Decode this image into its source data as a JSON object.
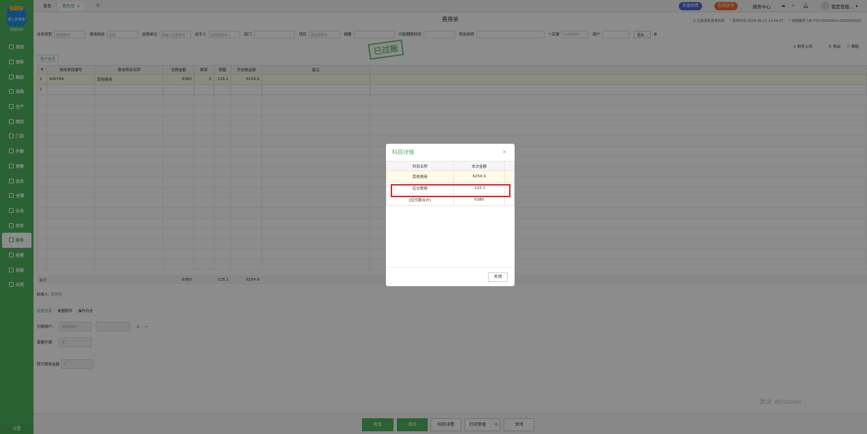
{
  "sidebar": {
    "logo_badge": "资讯企业",
    "logo_text": "网上管家婆",
    "brand": "网店ERP",
    "items": [
      {
        "label": "常用",
        "active": false
      },
      {
        "label": "资料",
        "active": false
      },
      {
        "label": "期初",
        "active": false
      },
      {
        "label": "采购",
        "active": false
      },
      {
        "label": "生产",
        "active": false
      },
      {
        "label": "网店",
        "active": false
      },
      {
        "label": "门店",
        "active": false
      },
      {
        "label": "外勤",
        "active": false
      },
      {
        "label": "销售",
        "active": false
      },
      {
        "label": "会员",
        "active": false
      },
      {
        "label": "仓储",
        "active": false
      },
      {
        "label": "云仓",
        "active": false
      },
      {
        "label": "库存",
        "active": false
      },
      {
        "label": "财务",
        "active": true
      },
      {
        "label": "经营",
        "active": false
      },
      {
        "label": "系统",
        "active": false
      },
      {
        "label": "应用",
        "active": false
      }
    ],
    "settings": "设置"
  },
  "topbar": {
    "tabs": [
      {
        "label": "首页"
      },
      {
        "label": "费用单",
        "close": "×"
      }
    ],
    "recharge": "充值续费",
    "consult": "在线咨询",
    "service": "服务中心",
    "user": "我是管理..."
  },
  "doc": {
    "title": "费用单",
    "posted_label": "过账更新录单时间",
    "date_label": "* 录单时间",
    "date": "2024-06-21 23:44:37",
    "no_label": "* 单据编号",
    "no": "CW-FYD-20240621-0000000001",
    "stamp": "已过账",
    "filters": [
      {
        "label": "业务类型",
        "value": "普通费用",
        "w": 46
      },
      {
        "label": "费用用途",
        "value": "采购",
        "w": 46
      },
      {
        "label": "结算单位",
        "value": "请输入往来单位",
        "w": 46
      },
      {
        "label": "经手人",
        "value": "请选择经手人",
        "w": 46
      },
      {
        "label": "部门",
        "value": "",
        "w": 60
      },
      {
        "label": "项目",
        "value": "请选择项目",
        "w": 46
      },
      {
        "label": "摘要",
        "value": "",
        "w": 60
      },
      {
        "label": "付款期限时间",
        "value": "",
        "w": 46
      },
      {
        "label": "附加说明",
        "value": "",
        "w": 100
      },
      {
        "label": "* 店铺",
        "value": "test0006",
        "w": 40
      },
      {
        "label": "账户",
        "value": "",
        "w": 40
      }
    ],
    "more": "更多...",
    "attach": "附件上传",
    "export": "导出",
    "help": "帮助",
    "subtab": "账户信息",
    "grid_headers": [
      "费用项目编号",
      "费用项目名称",
      "含税金额",
      "税率",
      "税额",
      "不含税金额",
      "备注"
    ],
    "rows": [
      {
        "idx": "1",
        "code": "600799",
        "name": "其他费用",
        "amount": "6380",
        "rate": "2",
        "tax": "125.1",
        "net": "6254.9",
        "remark": ""
      },
      {
        "idx": "2",
        "code": "",
        "name": "",
        "amount": "",
        "rate": "",
        "tax": "",
        "net": "",
        "remark": ""
      }
    ],
    "totals": {
      "label": "合计",
      "amount": "6380",
      "tax": "125.1",
      "net": "6254.9"
    },
    "maker_label": "制单人:",
    "maker": "管理员",
    "bottom_tabs": [
      "结算信息",
      "单据附件",
      "操作日志"
    ],
    "pay_account_label": "付款账户:",
    "pay_account": "请选择账户",
    "invoice_label": "需要开票:",
    "invoice": "否",
    "convert_label": "转为预收金额",
    "convert": "0"
  },
  "footer": {
    "new": "新增",
    "edit": "修改",
    "detail": "科目详情",
    "print": "打印单据",
    "close": "关闭"
  },
  "watermark": "激活 Windows",
  "modal": {
    "title": "科目详情",
    "close_x": "×",
    "headers": [
      "科目名称",
      "本次金额"
    ],
    "rows": [
      {
        "name": "其他费用",
        "amount": "6254.9"
      },
      {
        "name": "应交税费",
        "amount": "-125.1"
      },
      {
        "name": "[应付款合计]",
        "amount": "6380"
      }
    ],
    "close_button": "关闭"
  }
}
